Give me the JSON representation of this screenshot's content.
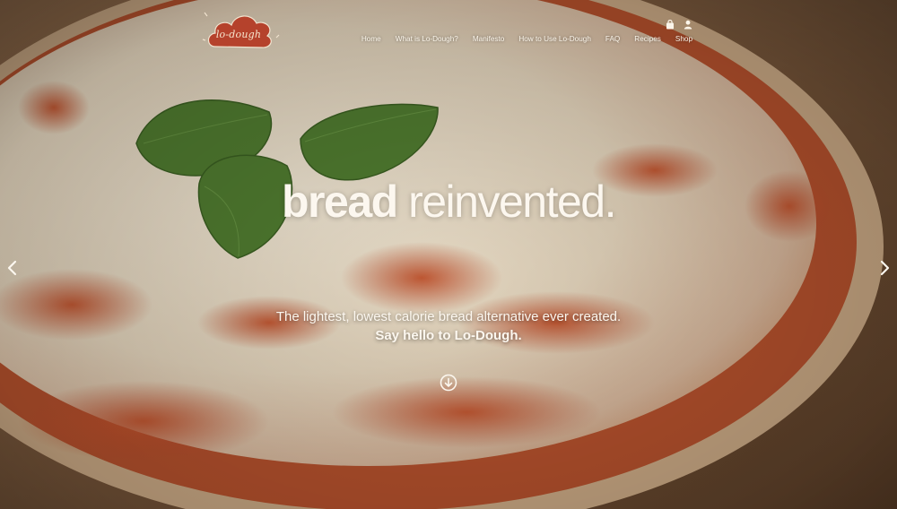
{
  "brand": {
    "logo_text": "lo-dough"
  },
  "nav": {
    "items": [
      {
        "label": "Home"
      },
      {
        "label": "What is Lo-Dough?"
      },
      {
        "label": "Manifesto"
      },
      {
        "label": "How to Use Lo-Dough"
      },
      {
        "label": "FAQ"
      },
      {
        "label": "Recipes"
      },
      {
        "label": "Shop"
      }
    ],
    "icons": [
      "shopping-bag-icon",
      "user-icon"
    ]
  },
  "hero": {
    "headline_bold": "bread",
    "headline_light": " reinvented.",
    "tagline_line1": "The lightest, lowest calorie bread alternative ever created.",
    "tagline_line2": "Say hello to Lo-Dough.",
    "scroll_icon": "arrow-down-circle-icon",
    "prev_icon": "chevron-left-icon",
    "next_icon": "chevron-right-icon"
  },
  "colors": {
    "logo_bg": "#b5422c",
    "text": "#fcf7ef",
    "sauce": "#b04a26",
    "cheese": "#e8dcc6",
    "crust": "#c9a37a",
    "wood": "#7a5638"
  }
}
